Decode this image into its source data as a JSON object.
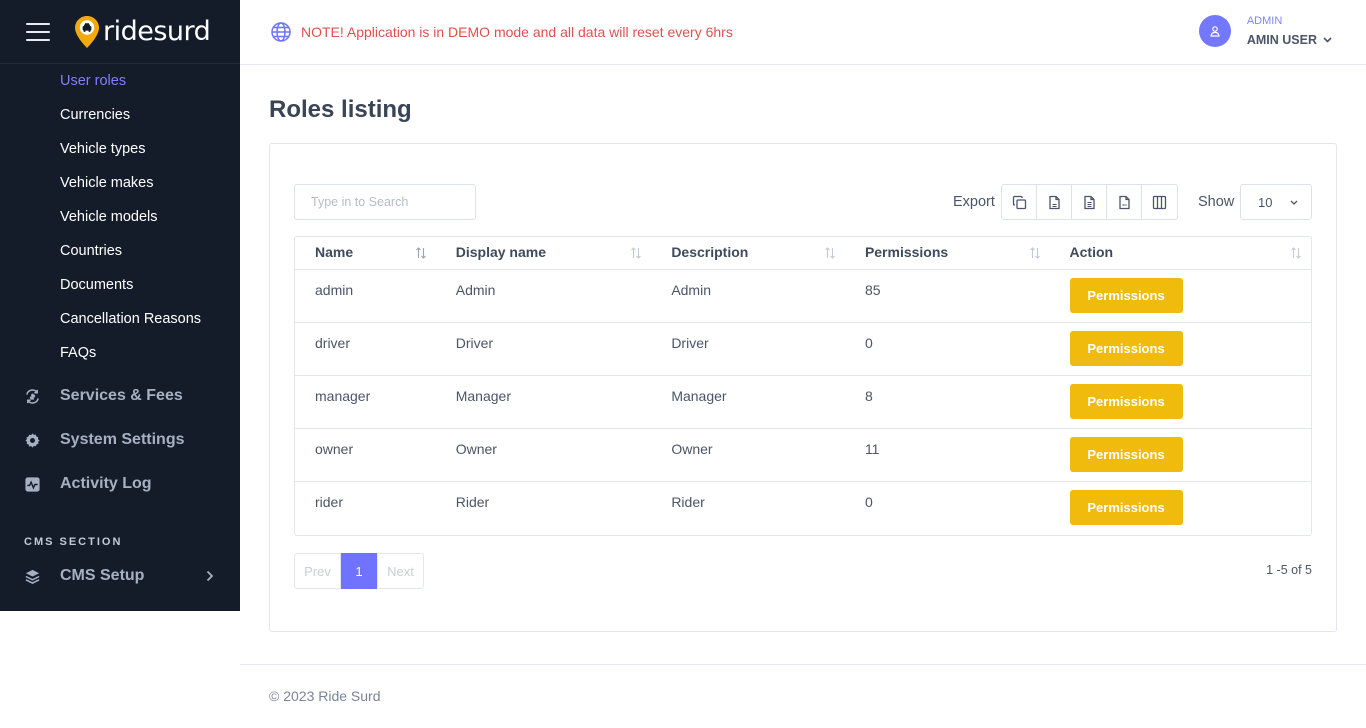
{
  "sidebar": {
    "brand": "ridesurd",
    "submenu": [
      {
        "label": "User roles",
        "active": true
      },
      {
        "label": "Currencies"
      },
      {
        "label": "Vehicle types"
      },
      {
        "label": "Vehicle makes"
      },
      {
        "label": "Vehicle models"
      },
      {
        "label": "Countries"
      },
      {
        "label": "Documents"
      },
      {
        "label": "Cancellation Reasons"
      },
      {
        "label": "FAQs"
      }
    ],
    "menu": [
      {
        "label": "Services & Fees",
        "icon": "services-fees-icon"
      },
      {
        "label": "System Settings",
        "icon": "settings-gear-icon"
      },
      {
        "label": "Activity Log",
        "icon": "activity-log-icon"
      }
    ],
    "cms_section_title": "CMS SECTION",
    "cms_setup": {
      "label": "CMS Setup",
      "icon": "layers-icon"
    }
  },
  "header": {
    "notice": "NOTE! Application is in DEMO mode and all data will reset every 6hrs",
    "user_role": "ADMIN",
    "user_name": "AMIN USER"
  },
  "main": {
    "title": "Roles listing",
    "search_placeholder": "Type in to Search",
    "export_label": "Export",
    "export_buttons": [
      "copy-icon",
      "csv-icon",
      "excel-icon",
      "pdf-icon",
      "columns-icon"
    ],
    "show_label": "Show",
    "page_size": "10",
    "columns": [
      "Name",
      "Display name",
      "Description",
      "Permissions",
      "Action"
    ],
    "rows": [
      {
        "name": "admin",
        "display": "Admin",
        "description": "Admin",
        "permissions": "85",
        "action": "Permissions"
      },
      {
        "name": "driver",
        "display": "Driver",
        "description": "Driver",
        "permissions": "0",
        "action": "Permissions"
      },
      {
        "name": "manager",
        "display": "Manager",
        "description": "Manager",
        "permissions": "8",
        "action": "Permissions"
      },
      {
        "name": "owner",
        "display": "Owner",
        "description": "Owner",
        "permissions": "11",
        "action": "Permissions"
      },
      {
        "name": "rider",
        "display": "Rider",
        "description": "Rider",
        "permissions": "0",
        "action": "Permissions"
      }
    ],
    "pagination": {
      "prev": "Prev",
      "current": "1",
      "next": "Next",
      "info": "1 -5 of 5"
    }
  },
  "footer": {
    "text": "© 2023 Ride Surd"
  },
  "colors": {
    "sidebar_bg": "#141c2a",
    "accent": "#6f73ff",
    "button": "#f1bb0e",
    "notice": "#e05050"
  }
}
